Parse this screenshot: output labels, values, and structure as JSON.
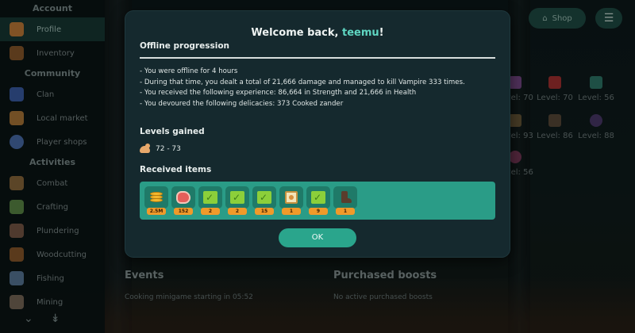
{
  "sidebar": {
    "sections": [
      {
        "title": "Account"
      },
      {
        "title": "Community"
      },
      {
        "title": "Activities"
      }
    ],
    "items": [
      {
        "label": "Profile",
        "icon": "home-icon",
        "active": true
      },
      {
        "label": "Inventory",
        "icon": "backpack-icon"
      },
      {
        "label": "Clan",
        "icon": "shield-icon"
      },
      {
        "label": "Local market",
        "icon": "market-icon"
      },
      {
        "label": "Player shops",
        "icon": "shop-icon"
      },
      {
        "label": "Combat",
        "icon": "sword-icon"
      },
      {
        "label": "Crafting",
        "icon": "hammer-icon"
      },
      {
        "label": "Plundering",
        "icon": "fist-icon"
      },
      {
        "label": "Woodcutting",
        "icon": "axe-icon"
      },
      {
        "label": "Fishing",
        "icon": "fish-icon"
      },
      {
        "label": "Mining",
        "icon": "pickaxe-icon"
      }
    ]
  },
  "topbar": {
    "shop_label": "Shop"
  },
  "background_levels": [
    "Level: 70",
    "Level: 70",
    "Level: 56",
    "Level: 93",
    "Level: 86",
    "Level: 88",
    "Level: 56"
  ],
  "background_panels": {
    "events_title": "Events",
    "events_text": "Cooking minigame starting in 05:52",
    "boosts_title": "Purchased boosts",
    "boosts_text": "No active purchased boosts"
  },
  "modal": {
    "title_prefix": "Welcome back, ",
    "username": "teemu",
    "title_suffix": "!",
    "section_title": "Offline progression",
    "log_lines": [
      "- You were offline for 4 hours",
      "- During that time, you dealt a total of 21,666 damage and managed to kill Vampire 333 times.",
      "- You received the following experience: 86,664 in Strength and 21,666 in Health",
      "- You devoured the following delicacies: 373 Cooked zander"
    ],
    "levels_heading": "Levels gained",
    "level_gain": "72 - 73",
    "items_heading": "Received items",
    "items": [
      {
        "icon": "coins-icon",
        "count": "2.5M"
      },
      {
        "icon": "raw-meat-icon",
        "count": "152"
      },
      {
        "icon": "herb-icon",
        "count": "2"
      },
      {
        "icon": "herb-icon",
        "count": "2"
      },
      {
        "icon": "herb-icon",
        "count": "15"
      },
      {
        "icon": "crate-icon",
        "count": "1"
      },
      {
        "icon": "herb-icon",
        "count": "9"
      },
      {
        "icon": "boot-icon",
        "count": "1"
      }
    ],
    "ok_label": "OK"
  },
  "colors": {
    "accent": "#2aa58c",
    "username": "#5fd6c2",
    "modal_bg": "#15292e",
    "badge": "#f09a2a"
  }
}
